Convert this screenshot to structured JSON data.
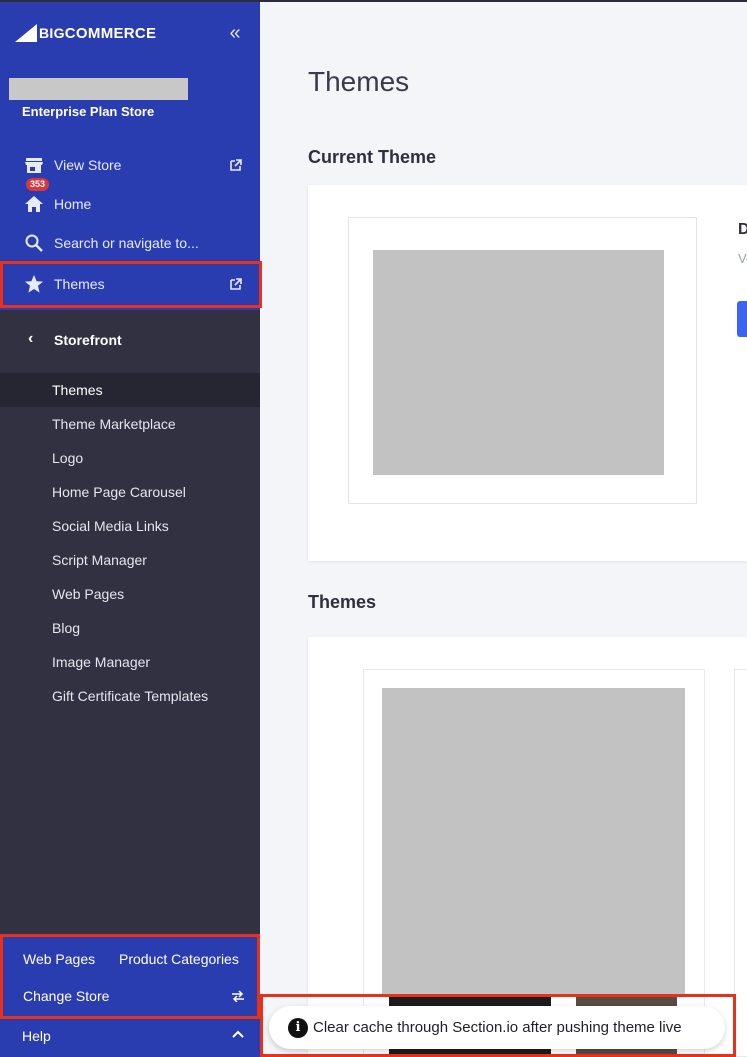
{
  "brand": {
    "logo_big": "BIG",
    "logo_rest": "COMMERCE"
  },
  "store": {
    "plan": "Enterprise Plan Store"
  },
  "nav": {
    "view_store": "View Store",
    "home": "Home",
    "home_badge": "353",
    "search": "Search or navigate to...",
    "themes": "Themes"
  },
  "storefront": {
    "title": "Storefront",
    "items": [
      "Themes",
      "Theme Marketplace",
      "Logo",
      "Home Page Carousel",
      "Social Media Links",
      "Script Manager",
      "Web Pages",
      "Blog",
      "Image Manager",
      "Gift Certificate Templates"
    ]
  },
  "shortcuts": {
    "web_pages": "Web Pages",
    "product_categories": "Product Categories",
    "change_store": "Change Store"
  },
  "help": "Help",
  "main": {
    "title": "Themes",
    "current_theme": "Current Theme",
    "current_name_partial": "D",
    "current_version_partial": "Ve",
    "themes_section": "Themes"
  },
  "toast": {
    "message": "Clear cache through Section.io after pushing theme live"
  },
  "colors": {
    "sidebar_blue": "#2a3db0",
    "sidebar_dark": "#313141",
    "highlight_red": "#e8311a",
    "primary_button": "#3c64f4",
    "badge_red": "#d9363e"
  }
}
